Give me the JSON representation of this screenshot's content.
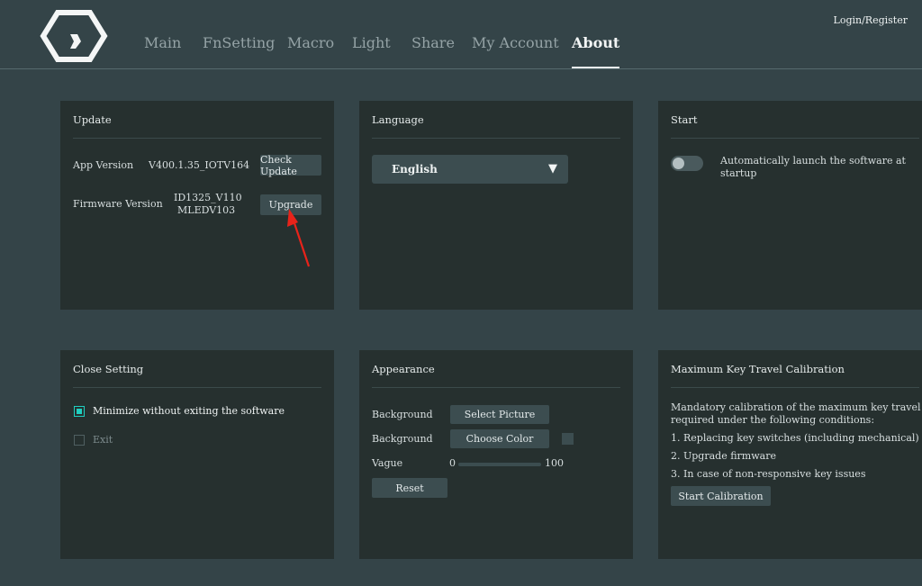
{
  "nav": {
    "items": [
      {
        "label": "Main"
      },
      {
        "label": "FnSetting"
      },
      {
        "label": "Macro"
      },
      {
        "label": "Light"
      },
      {
        "label": "Share"
      },
      {
        "label": "My Account"
      },
      {
        "label": "About"
      }
    ],
    "active": "About",
    "login": "Login/Register"
  },
  "update": {
    "title": "Update",
    "app_version_label": "App Version",
    "app_version_value": "V400.1.35_IOTV164",
    "check_update": "Check Update",
    "firmware_label": "Firmware Version",
    "firmware_line1": "ID1325_V110",
    "firmware_line2": "MLEDV103",
    "upgrade": "Upgrade"
  },
  "language": {
    "title": "Language",
    "selected": "English"
  },
  "start": {
    "title": "Start",
    "auto_launch_line1": "Automatically launch the software at",
    "auto_launch_line2": "startup",
    "auto_launch_enabled": false
  },
  "close_setting": {
    "title": "Close Setting",
    "minimize_label": "Minimize without exiting the software",
    "minimize_checked": true,
    "exit_label": "Exit",
    "exit_checked": false
  },
  "appearance": {
    "title": "Appearance",
    "background_label_1": "Background",
    "select_picture": "Select Picture",
    "background_label_2": "Background",
    "choose_color": "Choose Color",
    "vague_label": "Vague",
    "vague_min": "0",
    "vague_max": "100",
    "reset": "Reset"
  },
  "calibration": {
    "title": "Maximum Key Travel Calibration",
    "desc_line1": "Mandatory calibration of the maximum key travel is",
    "desc_line2": "required under the following conditions:",
    "item1": "1. Replacing key switches (including mechanical)",
    "item2": "2. Upgrade firmware",
    "item3": "3. In case of non-responsive key issues",
    "start_button": "Start Calibration"
  },
  "colors": {
    "background": "#344448",
    "panel": "#26302f",
    "button": "#3c4d50",
    "accent": "#1fcfc0",
    "annotation_arrow": "#e8231a"
  }
}
